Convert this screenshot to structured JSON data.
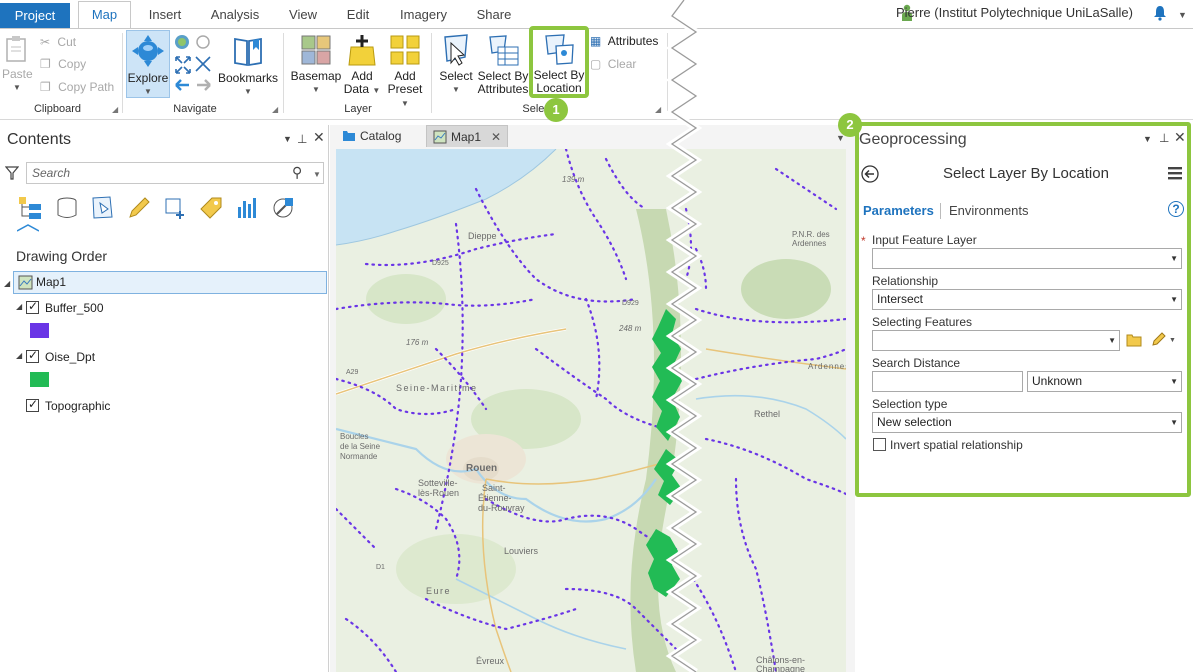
{
  "ribbon_tabs": [
    "Project",
    "Map",
    "Insert",
    "Analysis",
    "View",
    "Edit",
    "Imagery",
    "Share"
  ],
  "user": {
    "name": "Pierre (Institut Polytechnique UniLaSalle)"
  },
  "clipboard": {
    "paste": "Paste",
    "cut": "Cut",
    "copy": "Copy",
    "copy_path": "Copy Path",
    "group": "Clipboard"
  },
  "navigate": {
    "explore": "Explore",
    "bookmarks": "Bookmarks",
    "group": "Navigate"
  },
  "layer_group": {
    "basemap": "Basemap",
    "add_data_1": "Add",
    "add_data_2": "Data",
    "add_preset_1": "Add",
    "add_preset_2": "Preset",
    "group": "Layer"
  },
  "selection": {
    "select": "Select",
    "select_by_attr_1": "Select By",
    "select_by_attr_2": "Attributes",
    "select_by_loc_1": "Select By",
    "select_by_loc_2": "Location",
    "attributes": "Attributes",
    "clear": "Clear",
    "group": "Selection"
  },
  "callouts": {
    "one": "1",
    "two": "2"
  },
  "contents": {
    "title": "Contents",
    "search_placeholder": "Search",
    "drawing_order": "Drawing Order",
    "map": "Map1",
    "layers": [
      {
        "name": "Buffer_500",
        "color": "#6a35e6"
      },
      {
        "name": "Oise_Dpt",
        "color": "#22bb55"
      },
      {
        "name": "Topographic"
      }
    ]
  },
  "view_tabs": {
    "catalog": "Catalog",
    "map1": "Map1"
  },
  "map_labels": {
    "dieppe": "Dieppe",
    "seine_maritime": "Seine-Maritime",
    "rouen": "Rouen",
    "sotteville": "Sotteville-",
    "les_rouen": "lès-Rouen",
    "saint_etienne": "Saint-",
    "etienne_du": "Étienne-",
    "du_rouvray": "du-Rouvray",
    "boucles_1": "Boucles",
    "boucles_2": "de la Seine",
    "boucles_3": "Normande",
    "louviers": "Louviers",
    "eure": "Eure",
    "evreux": "Évreux",
    "h139": "139 m",
    "h176": "176 m",
    "h248": "248 m",
    "pnr": "P.N.R. des",
    "ardennes": "Ardennes",
    "ardennes_dept": "Ardennes",
    "rethel": "Rethel",
    "chalons": "Châlons-en-",
    "champagne": "Champagne",
    "d925": "D925",
    "d929": "D929",
    "a29": "A29",
    "d1": "D1"
  },
  "geoprocessing": {
    "title": "Geoprocessing",
    "tool": "Select Layer By Location",
    "tab_parameters": "Parameters",
    "tab_environments": "Environments",
    "input_label": "Input Feature Layer",
    "input_value": "",
    "relationship_label": "Relationship",
    "relationship_value": "Intersect",
    "selecting_label": "Selecting Features",
    "selecting_value": "",
    "distance_label": "Search Distance",
    "distance_value": "",
    "distance_unit": "Unknown",
    "selection_type_label": "Selection type",
    "selection_type_value": "New selection",
    "invert_label": "Invert spatial relationship"
  },
  "colors": {
    "accent": "#1e73be",
    "highlight": "#8dc63f",
    "buffer": "#6a35e6",
    "oise": "#22bb55"
  }
}
